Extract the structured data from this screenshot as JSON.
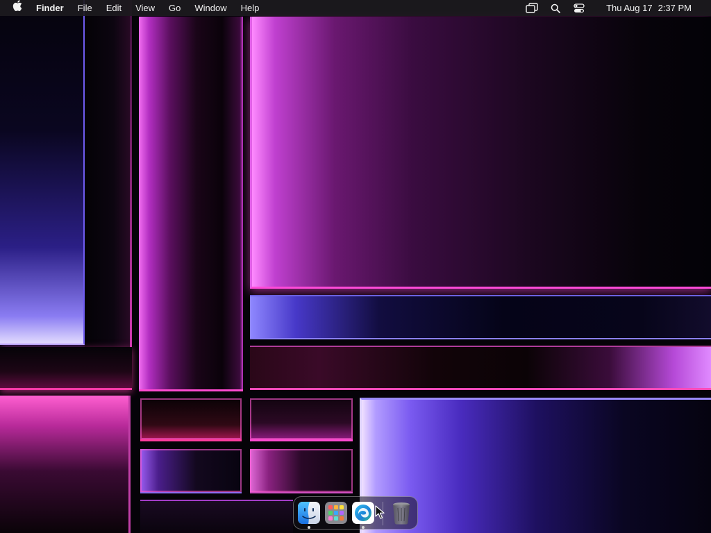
{
  "menubar": {
    "apple_icon": "apple-icon",
    "app_name": "Finder",
    "menus": [
      "File",
      "Edit",
      "View",
      "Go",
      "Window",
      "Help"
    ],
    "status_icons": [
      "screen-mirroring-icon",
      "spotlight-search-icon",
      "control-center-icon"
    ],
    "clock": {
      "date": "Thu Aug 17",
      "time": "2:37 PM"
    }
  },
  "dock": {
    "apps": [
      {
        "name": "Finder",
        "icon": "finder-icon",
        "running": true
      },
      {
        "name": "Launchpad",
        "icon": "launchpad-icon",
        "running": false
      },
      {
        "name": "Microsoft Edge",
        "icon": "edge-icon",
        "running": true
      }
    ],
    "trash": {
      "name": "Trash",
      "icon": "trash-icon"
    }
  },
  "colors": {
    "menubar_bg": "#1c1a1e",
    "wallpaper_accent_magenta": "#ff4ad8",
    "wallpaper_accent_violet": "#7a5af0"
  }
}
